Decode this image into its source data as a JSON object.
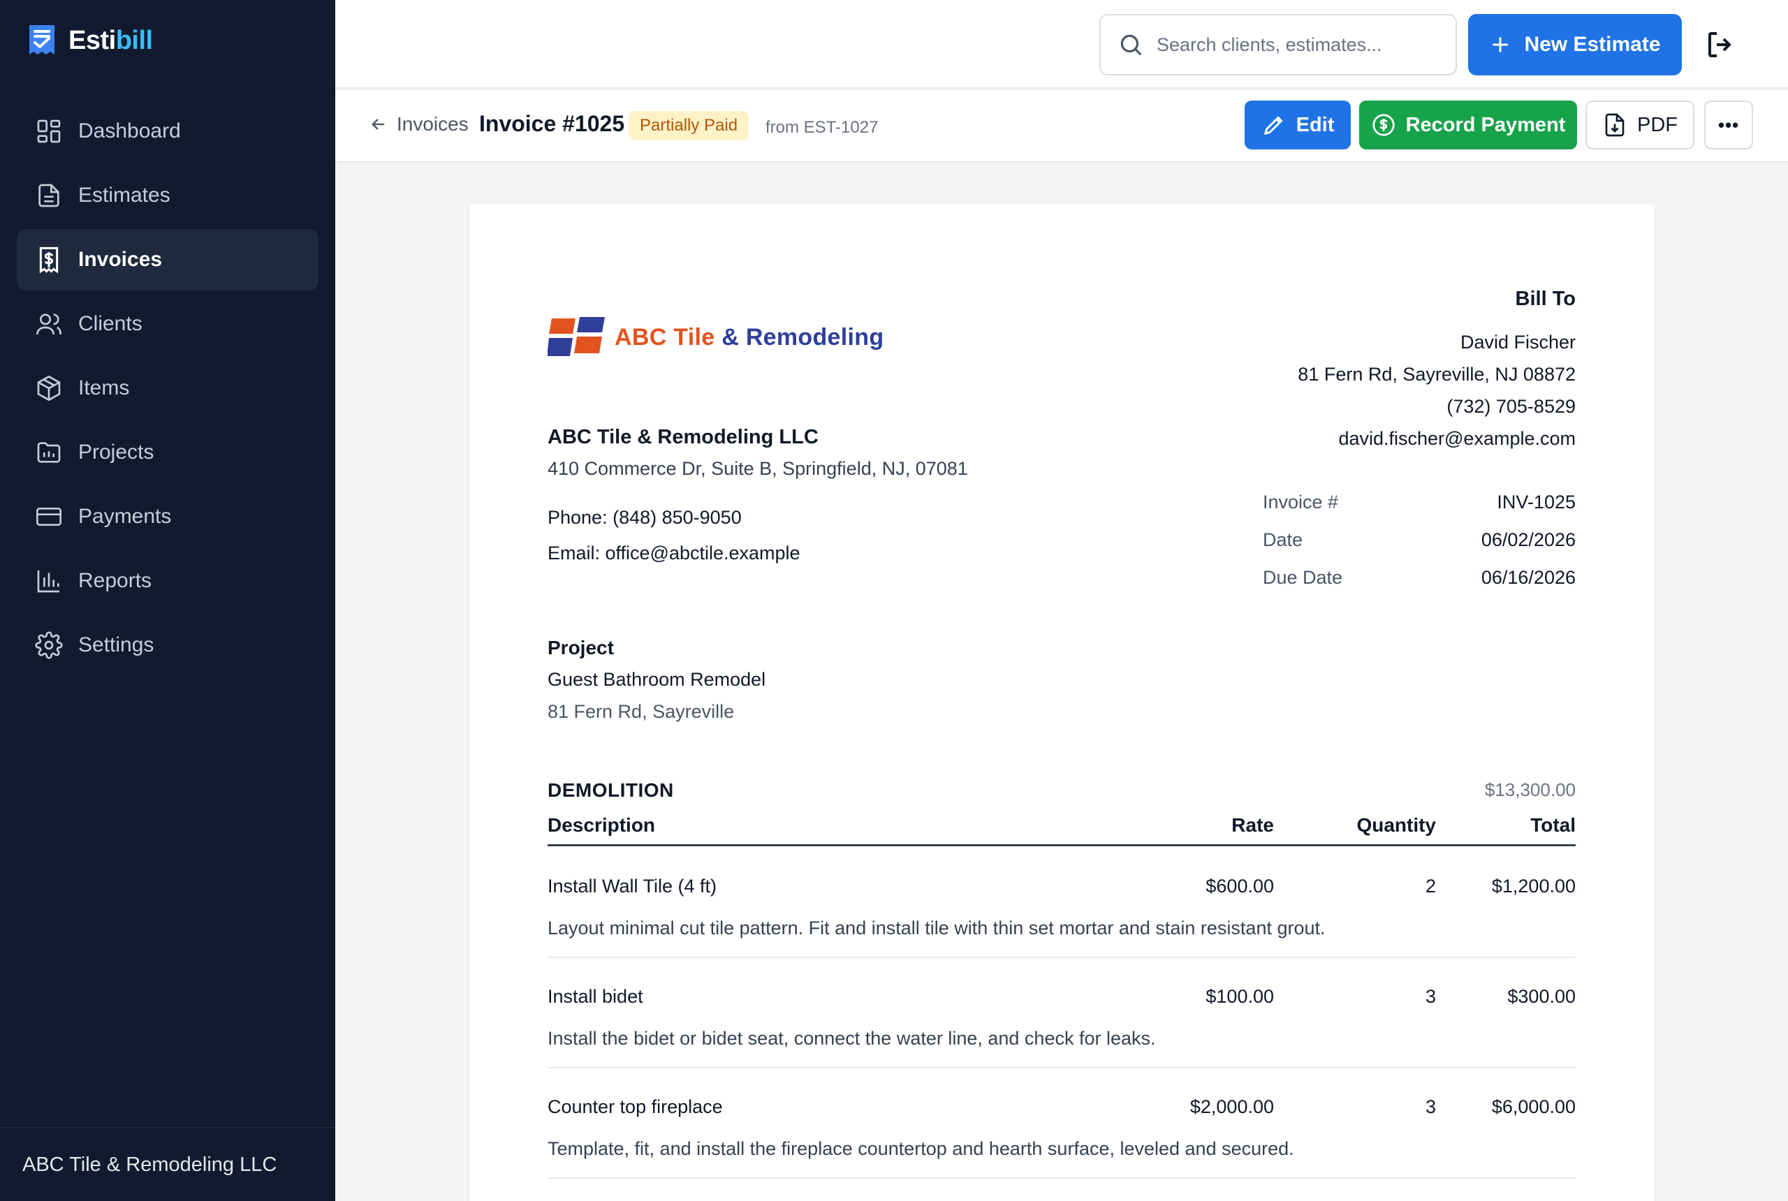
{
  "app": {
    "brand_prefix": "Esti",
    "brand_suffix": "bill",
    "company_footer": "ABC Tile & Remodeling LLC"
  },
  "sidebar": {
    "items": [
      {
        "label": "Dashboard",
        "icon": "dashboard-icon"
      },
      {
        "label": "Estimates",
        "icon": "document-icon"
      },
      {
        "label": "Invoices",
        "icon": "invoice-icon",
        "active": true
      },
      {
        "label": "Clients",
        "icon": "users-icon"
      },
      {
        "label": "Items",
        "icon": "box-icon"
      },
      {
        "label": "Projects",
        "icon": "folder-icon"
      },
      {
        "label": "Payments",
        "icon": "card-icon"
      },
      {
        "label": "Reports",
        "icon": "bar-chart-icon"
      },
      {
        "label": "Settings",
        "icon": "gear-icon"
      }
    ]
  },
  "topbar": {
    "search_placeholder": "Search clients, estimates...",
    "new_estimate_label": "New Estimate"
  },
  "subheader": {
    "back_label": "Invoices",
    "title": "Invoice #1025",
    "status": "Partially Paid",
    "source": "from EST-1027",
    "edit_label": "Edit",
    "record_payment_label": "Record Payment",
    "pdf_label": "PDF",
    "more_label": "•••"
  },
  "invoice": {
    "logo_text_1": "ABC Tile",
    "logo_text_2": "& Remodeling",
    "company": {
      "name": "ABC Tile & Remodeling LLC",
      "address": "410 Commerce Dr, Suite B, Springfield, NJ, 07081",
      "phone": "Phone: (848) 850-9050",
      "email": "Email: office@abctile.example"
    },
    "bill_to": {
      "title": "Bill To",
      "name": "David Fischer",
      "address": "81 Fern Rd, Sayreville, NJ 08872",
      "phone": "(732) 705-8529",
      "email": "david.fischer@example.com"
    },
    "meta": [
      {
        "label": "Invoice #",
        "value": "INV-1025"
      },
      {
        "label": "Date",
        "value": "06/02/2026"
      },
      {
        "label": "Due Date",
        "value": "06/16/2026"
      }
    ],
    "project": {
      "title": "Project",
      "name": "Guest Bathroom Remodel",
      "address": "81 Fern Rd, Sayreville"
    },
    "section": {
      "title": "DEMOLITION",
      "total": "$13,300.00",
      "columns": [
        "Description",
        "Rate",
        "Quantity",
        "Total"
      ],
      "rows": [
        {
          "name": "Install Wall Tile (4 ft)",
          "rate": "$600.00",
          "qty": "2",
          "total": "$1,200.00",
          "desc": "Layout minimal cut tile pattern. Fit and install tile with thin set mortar and stain resistant grout."
        },
        {
          "name": "Install bidet",
          "rate": "$100.00",
          "qty": "3",
          "total": "$300.00",
          "desc": "Install the bidet or bidet seat, connect the water line, and check for leaks."
        },
        {
          "name": "Counter top fireplace",
          "rate": "$2,000.00",
          "qty": "3",
          "total": "$6,000.00",
          "desc": "Template, fit, and install the fireplace countertop and hearth surface, leveled and secured."
        }
      ]
    }
  }
}
